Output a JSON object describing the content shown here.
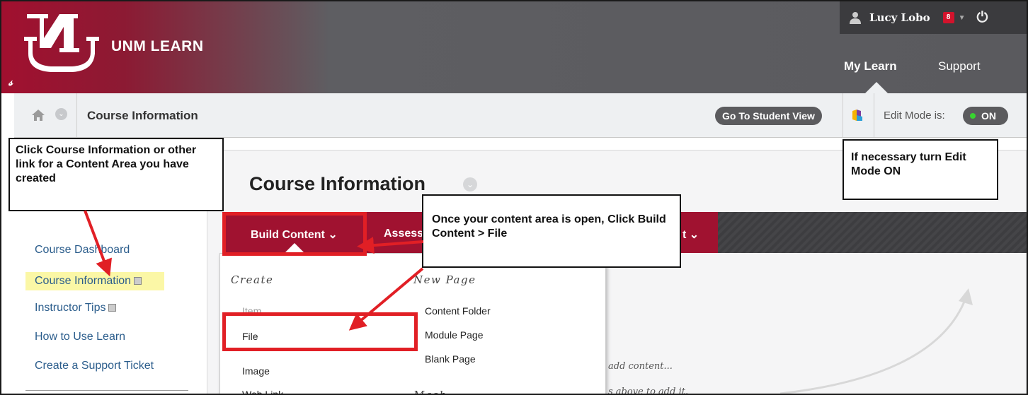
{
  "header": {
    "brand": "UNM LEARN",
    "user_name": "Lucy Lobo",
    "notification_count": "8",
    "nav": [
      "My Learn",
      "Support"
    ]
  },
  "breadcrumb": {
    "title": "Course Information",
    "student_view": "Go To Student View",
    "edit_mode_label": "Edit Mode is:",
    "edit_mode_value": "ON"
  },
  "page": {
    "title": "Course Information",
    "actions": [
      "Build Content",
      "Assess",
      "t"
    ]
  },
  "sidebar": {
    "items": [
      {
        "label": "Course Dashboard"
      },
      {
        "label": "Course Information"
      },
      {
        "label": "Instructor Tips"
      },
      {
        "label": "How to Use Learn"
      },
      {
        "label": "Create a Support Ticket"
      }
    ]
  },
  "menu": {
    "create_heading": "Create",
    "new_page_heading": "New Page",
    "mashups_heading": "Mash",
    "create_items": [
      "Item",
      "File",
      "Image",
      "Web Link"
    ],
    "new_page_items": [
      "Content Folder",
      "Module Page",
      "Blank Page"
    ]
  },
  "background_text": [
    "add content...",
    "s above to add it."
  ],
  "callouts": {
    "left": "Click Course Information or other link for a Content Area you have created",
    "mid": "Once your content area is open, Click Build Content > File",
    "right": "If necessary turn Edit Mode ON"
  },
  "colors": {
    "brand_red": "#a01230",
    "annotation_red": "#e11f25",
    "toggle_green": "#38d430"
  }
}
